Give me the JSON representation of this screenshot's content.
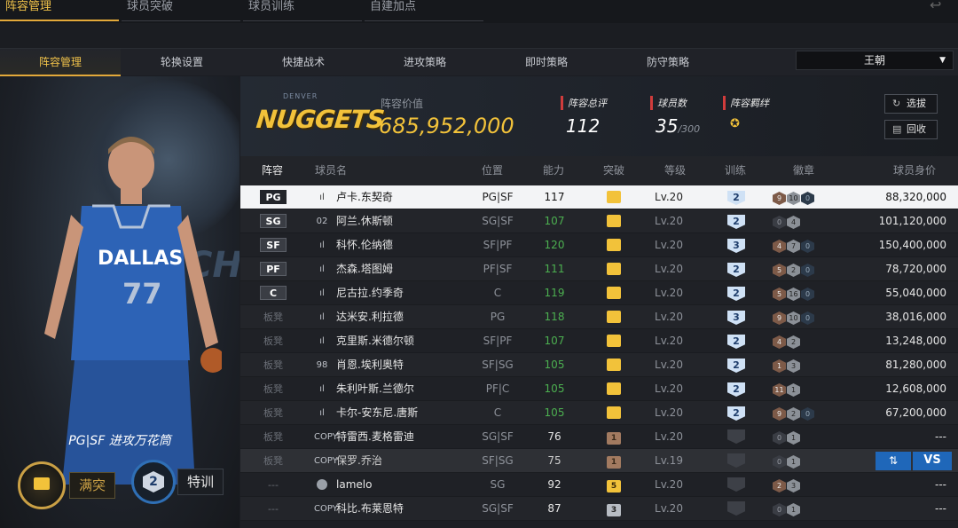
{
  "top_tabs": [
    "阵容管理",
    "球员突破",
    "球员训练",
    "自建加点"
  ],
  "sub_tabs": [
    "阵容管理",
    "轮换设置",
    "快捷战术",
    "进攻策略",
    "即时策略",
    "防守策略"
  ],
  "team_select": "王朝",
  "player_card": {
    "position_text": "PG|SF 进攻万花筒",
    "break_button": "满突",
    "train_level": "2",
    "train_button": "特训",
    "jersey": "DALLAS",
    "jersey_number": "77"
  },
  "summary": {
    "team_logo": "NUGGETS",
    "team_logo_sub": "DENVER",
    "value_label": "阵容价值",
    "value": "685,952,000",
    "rating_label": "阵容总评",
    "rating": "112",
    "count_label": "球员数",
    "count": "35",
    "count_max": "/300",
    "bond_label": "阵容羁绊",
    "pick_button": "选拔",
    "recycle_button": "回收"
  },
  "table": {
    "headers": [
      "阵容",
      "球员名",
      "位置",
      "能力",
      "突破",
      "等级",
      "训练",
      "徽章",
      "球员身价"
    ],
    "rows": [
      {
        "slot": "PG",
        "slot_badge": true,
        "icon": "ıl",
        "name": "卢卡.东契奇",
        "pos": "PG|SF",
        "ability": "117",
        "green": false,
        "break": "crown",
        "level": "Lv.20",
        "train": "2",
        "badges": [
          [
            "b",
            "9"
          ],
          [
            "s",
            "10"
          ],
          [
            "g",
            "0"
          ]
        ],
        "value": "88,320,000",
        "selected": true
      },
      {
        "slot": "SG",
        "slot_badge": true,
        "icon": "02",
        "name": "阿兰.休斯顿",
        "pos": "SG|SF",
        "ability": "107",
        "green": true,
        "break": "crown",
        "level": "Lv.20",
        "train": "2",
        "badges": [
          [
            "d",
            "0"
          ],
          [
            "s",
            "4"
          ]
        ],
        "value": "101,120,000"
      },
      {
        "slot": "SF",
        "slot_badge": true,
        "icon": "ıl",
        "name": "科怀.伦纳德",
        "pos": "SF|PF",
        "ability": "120",
        "green": true,
        "break": "crown",
        "level": "Lv.20",
        "train": "3",
        "badges": [
          [
            "b",
            "4"
          ],
          [
            "s",
            "7"
          ],
          [
            "g",
            "0"
          ]
        ],
        "value": "150,400,000"
      },
      {
        "slot": "PF",
        "slot_badge": true,
        "icon": "ıl",
        "name": "杰森.塔图姆",
        "pos": "PF|SF",
        "ability": "111",
        "green": true,
        "break": "crown",
        "level": "Lv.20",
        "train": "2",
        "badges": [
          [
            "b",
            "5"
          ],
          [
            "s",
            "2"
          ],
          [
            "g",
            "0"
          ]
        ],
        "value": "78,720,000"
      },
      {
        "slot": "C",
        "slot_badge": true,
        "icon": "ıl",
        "name": "尼古拉.约季奇",
        "pos": "C",
        "ability": "119",
        "green": true,
        "break": "crown",
        "level": "Lv.20",
        "train": "2",
        "badges": [
          [
            "b",
            "5"
          ],
          [
            "s",
            "16"
          ],
          [
            "g",
            "0"
          ]
        ],
        "value": "55,040,000"
      },
      {
        "slot": "板凳",
        "slot_badge": false,
        "icon": "ıl",
        "name": "达米安.利拉德",
        "pos": "PG",
        "ability": "118",
        "green": true,
        "break": "crown",
        "level": "Lv.20",
        "train": "3",
        "badges": [
          [
            "b",
            "9"
          ],
          [
            "s",
            "10"
          ],
          [
            "g",
            "0"
          ]
        ],
        "value": "38,016,000"
      },
      {
        "slot": "板凳",
        "slot_badge": false,
        "icon": "ıl",
        "name": "克里斯.米德尔顿",
        "pos": "SF|PF",
        "ability": "107",
        "green": true,
        "break": "crown",
        "level": "Lv.20",
        "train": "2",
        "badges": [
          [
            "b",
            "4"
          ],
          [
            "s",
            "2"
          ]
        ],
        "value": "13,248,000"
      },
      {
        "slot": "板凳",
        "slot_badge": false,
        "icon": "98",
        "name": "肖恩.埃利奥特",
        "pos": "SF|SG",
        "ability": "105",
        "green": true,
        "break": "crown",
        "level": "Lv.20",
        "train": "2",
        "badges": [
          [
            "b",
            "1"
          ],
          [
            "s",
            "3"
          ]
        ],
        "value": "81,280,000"
      },
      {
        "slot": "板凳",
        "slot_badge": false,
        "icon": "ıl",
        "name": "朱利叶斯.兰德尔",
        "pos": "PF|C",
        "ability": "105",
        "green": true,
        "break": "crown",
        "level": "Lv.20",
        "train": "2",
        "badges": [
          [
            "b",
            "11"
          ],
          [
            "s",
            "1"
          ]
        ],
        "value": "12,608,000"
      },
      {
        "slot": "板凳",
        "slot_badge": false,
        "icon": "ıl",
        "name": "卡尔-安东尼.唐斯",
        "pos": "C",
        "ability": "105",
        "green": true,
        "break": "crown",
        "level": "Lv.20",
        "train": "2",
        "badges": [
          [
            "b",
            "9"
          ],
          [
            "s",
            "2"
          ],
          [
            "g",
            "0"
          ]
        ],
        "value": "67,200,000"
      },
      {
        "slot": "板凳",
        "slot_badge": false,
        "icon": "COPY",
        "name": "特雷西.麦格雷迪",
        "pos": "SG|SF",
        "ability": "76",
        "green": false,
        "break": "1",
        "break_tier": "bronze",
        "level": "Lv.20",
        "train": "",
        "badges": [
          [
            "d",
            "0"
          ],
          [
            "s",
            "1"
          ]
        ],
        "value": "---"
      },
      {
        "slot": "板凳",
        "slot_badge": false,
        "icon": "COPY",
        "name": "保罗.乔治",
        "pos": "SF|SG",
        "ability": "75",
        "green": false,
        "break": "1",
        "break_tier": "bronze",
        "level": "Lv.19",
        "train": "",
        "badges": [
          [
            "d",
            "0"
          ],
          [
            "s",
            "1"
          ]
        ],
        "value": "",
        "dim": true,
        "vs": true
      },
      {
        "slot": "---",
        "slot_badge": false,
        "icon": "avatar",
        "name": "lamelo",
        "pos": "SG",
        "ability": "92",
        "green": false,
        "break": "5",
        "break_tier": "gold",
        "level": "Lv.20",
        "train": "",
        "badges": [
          [
            "b",
            "2"
          ],
          [
            "s",
            "3"
          ]
        ],
        "value": "---"
      },
      {
        "slot": "---",
        "slot_badge": false,
        "icon": "COPY",
        "name": "科比.布莱恩特",
        "pos": "SG|SF",
        "ability": "87",
        "green": false,
        "break": "3",
        "break_tier": "silver",
        "level": "Lv.20",
        "train": "",
        "badges": [
          [
            "d",
            "0"
          ],
          [
            "s",
            "1"
          ]
        ],
        "value": "---"
      }
    ],
    "vs_label": "VS",
    "swap_symbol": "⇅"
  },
  "colors": {
    "accent": "#f0c24a",
    "ability_green": "#4caf50",
    "vs_blue": "#1f67b9"
  }
}
